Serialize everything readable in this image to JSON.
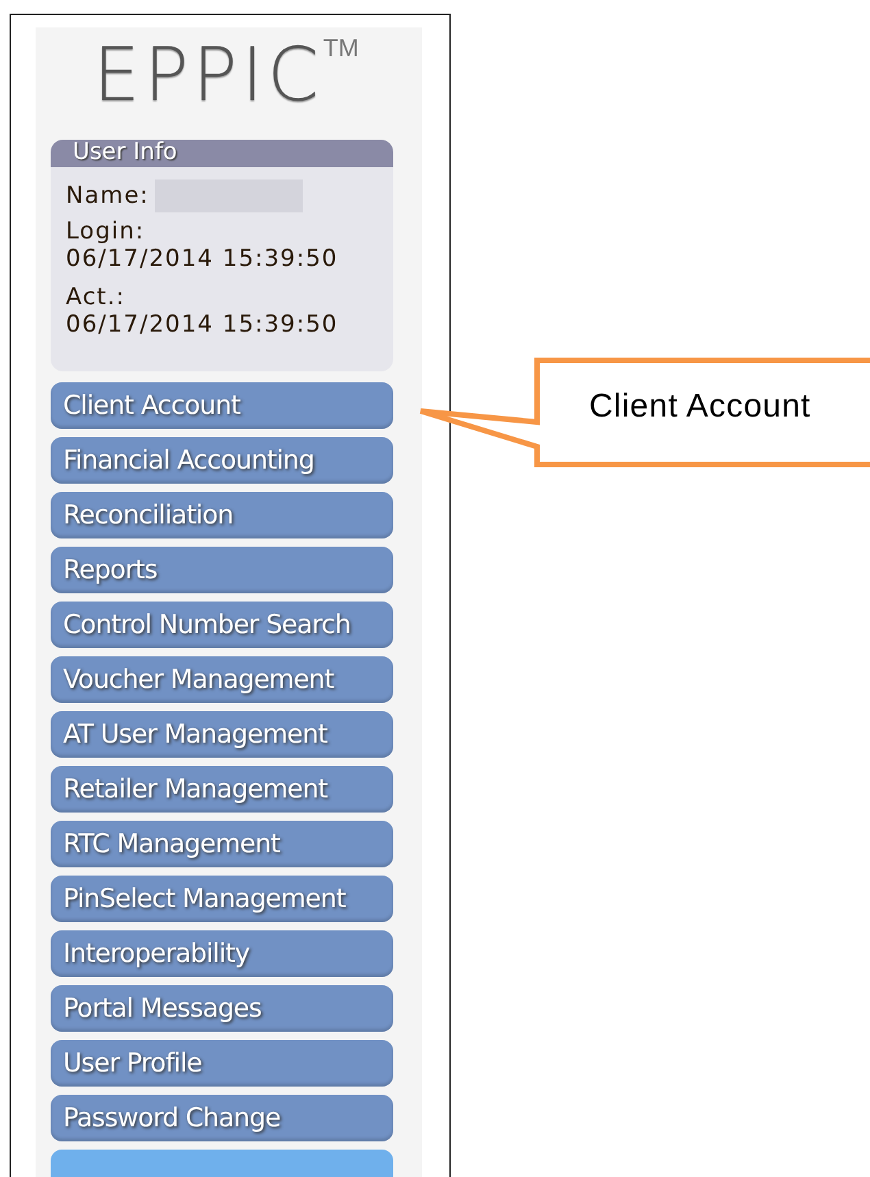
{
  "logo": {
    "text": "EPPIC",
    "mark": "TM"
  },
  "user_info": {
    "title": "User Info",
    "fields": [
      {
        "label": "Name:",
        "redacted": true
      },
      {
        "label": "Login:",
        "value": "06/17/2014 15:39:50"
      },
      {
        "label": "Act.:",
        "value": "06/17/2014 15:39:50"
      }
    ]
  },
  "menu": [
    {
      "label": "Client Account"
    },
    {
      "label": "Financial Accounting"
    },
    {
      "label": "Reconciliation"
    },
    {
      "label": "Reports"
    },
    {
      "label": "Control Number Search"
    },
    {
      "label": "Voucher Management"
    },
    {
      "label": "AT User Management"
    },
    {
      "label": "Retailer Management"
    },
    {
      "label": "RTC Management"
    },
    {
      "label": "PinSelect Management"
    },
    {
      "label": "Interoperability"
    },
    {
      "label": "Portal Messages"
    },
    {
      "label": "User Profile"
    },
    {
      "label": "Password Change"
    }
  ],
  "callout": {
    "text": "Client Account"
  }
}
